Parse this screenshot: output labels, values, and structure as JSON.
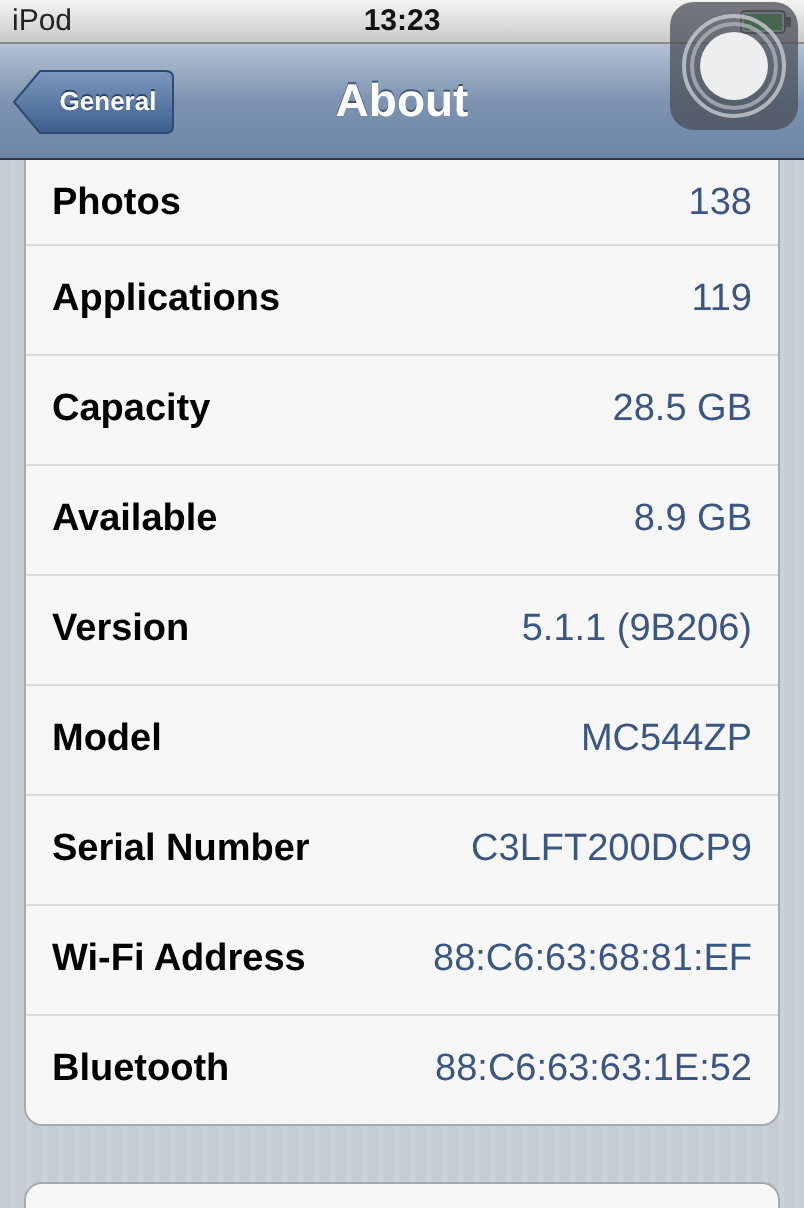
{
  "status_bar": {
    "carrier": "iPod",
    "time": "13:23"
  },
  "nav": {
    "title": "About",
    "back": "General"
  },
  "rows": [
    {
      "label": "Photos",
      "value": "138"
    },
    {
      "label": "Applications",
      "value": "119"
    },
    {
      "label": "Capacity",
      "value": "28.5 GB"
    },
    {
      "label": "Available",
      "value": "8.9 GB"
    },
    {
      "label": "Version",
      "value": "5.1.1 (9B206)"
    },
    {
      "label": "Model",
      "value": "MC544ZP"
    },
    {
      "label": "Serial Number",
      "value": "C3LFT200DCP9"
    },
    {
      "label": "Wi-Fi Address",
      "value": "88:C6:63:68:81:EF"
    },
    {
      "label": "Bluetooth",
      "value": "88:C6:63:63:1E:52"
    }
  ]
}
